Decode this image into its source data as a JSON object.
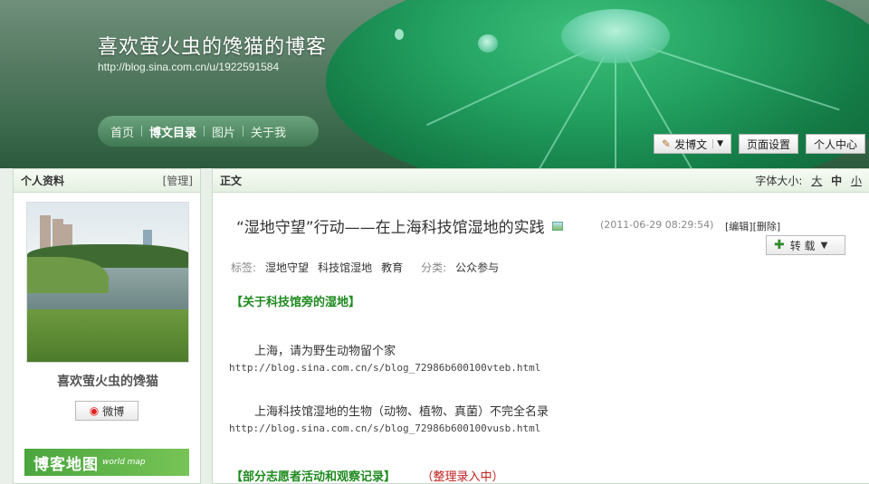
{
  "header": {
    "blog_title": "喜欢萤火虫的馋猫的博客",
    "blog_url": "http://blog.sina.com.cn/u/1922591584",
    "nav": [
      {
        "label": "首页"
      },
      {
        "label": "博文目录"
      },
      {
        "label": "图片"
      },
      {
        "label": "关于我"
      }
    ],
    "buttons": {
      "post": "发博文",
      "page_settings": "页面设置",
      "personal_center": "个人中心"
    }
  },
  "sidebar": {
    "title": "个人资料",
    "manage": "[管理]",
    "username": "喜欢萤火虫的馋猫",
    "weibo": "微博",
    "map_title": "博客地图",
    "map_sub": "world map"
  },
  "main": {
    "title": "正文",
    "font_size_label": "字体大小:",
    "font_sizes": [
      "大",
      "中",
      "小"
    ],
    "post_title": "“湿地守望”行动——在上海科技馆湿地的实践",
    "post_time": "(2011-06-29 08:29:54)",
    "post_ops": "[编辑][删除]",
    "repost": "转 载",
    "tags_label": "标签:",
    "tags": [
      "湿地守望",
      "科技馆湿地",
      "教育"
    ],
    "category_label": "分类:",
    "category": "公众参与",
    "section1": "【关于科技馆旁的湿地】",
    "para1": "上海，请为野生动物留个家",
    "url1": "http://blog.sina.com.cn/s/blog_72986b600100vteb.html",
    "para2": "上海科技馆湿地的生物（动物、植物、真菌）不完全名录",
    "url2": "http://blog.sina.com.cn/s/blog_72986b600100vusb.html",
    "section2": "【部分志愿者活动和观察记录】",
    "section2_note": "（整理录入中）"
  },
  "colors": {
    "accent_green": "#1f8a1f",
    "note_red": "#c02020"
  }
}
